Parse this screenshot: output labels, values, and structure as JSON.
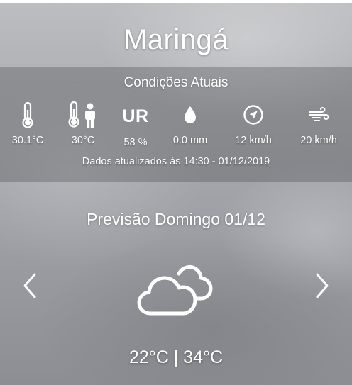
{
  "header": {
    "city": "Maringá"
  },
  "current": {
    "title": "Condições Atuais",
    "metrics": [
      {
        "icon": "thermometer-icon",
        "value": "30.1°C"
      },
      {
        "icon": "thermometer-person-icon",
        "value": "30°C"
      },
      {
        "icon": "humidity-icon",
        "label": "UR",
        "value": "58 %"
      },
      {
        "icon": "raindrop-icon",
        "value": "0.0 mm"
      },
      {
        "icon": "wind-direction-icon",
        "value": "12 km/h"
      },
      {
        "icon": "wind-gust-icon",
        "value": "20 km/h"
      }
    ],
    "updated": "Dados atualizados às 14:30 - 01/12/2019"
  },
  "forecast": {
    "title": "Previsão Domingo 01/12",
    "icon": "cloudy-icon",
    "temps": "22°C | 34°C",
    "prev_icon": "chevron-left-icon",
    "next_icon": "chevron-right-icon"
  },
  "colors": {
    "text": "#ffffff",
    "panel_overlay": "rgba(70,72,76,0.32)"
  }
}
